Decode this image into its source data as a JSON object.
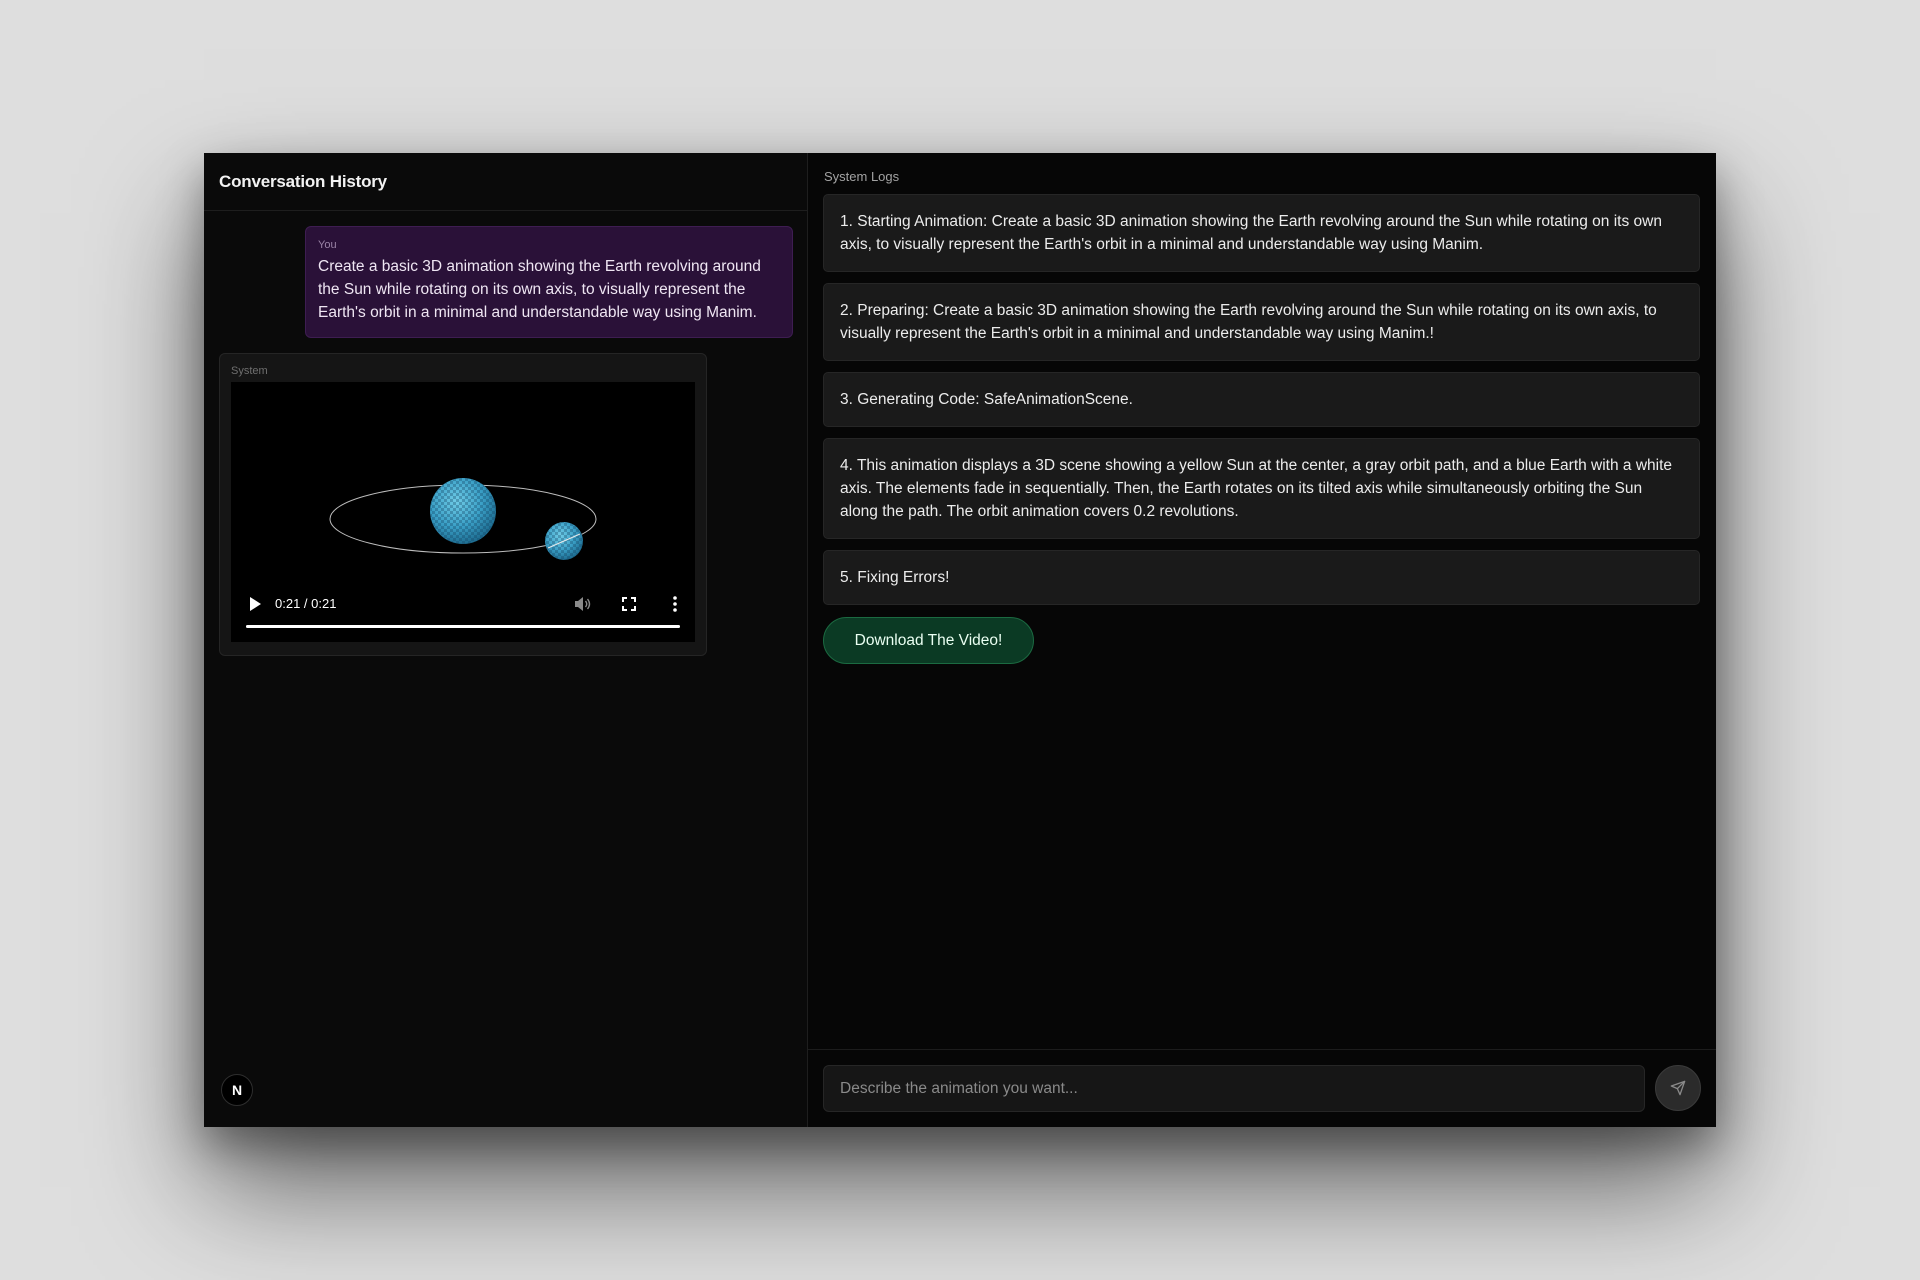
{
  "left_panel": {
    "title": "Conversation History",
    "user_message": {
      "label": "You",
      "text": "Create a basic 3D animation showing the Earth revolving around the Sun while rotating on its own axis, to visually represent the Earth's orbit in a minimal and understandable way using Manim."
    },
    "system_message": {
      "label": "System",
      "video": {
        "time": "0:21 / 0:21",
        "progress": 1.0,
        "icons": [
          "play-icon",
          "volume-icon",
          "fullscreen-icon",
          "more-options-icon"
        ]
      }
    },
    "logo": "N"
  },
  "right_panel": {
    "title": "System Logs",
    "logs": [
      "1. Starting Animation: Create a basic 3D animation showing the Earth revolving around the Sun while rotating on its own axis, to visually represent the Earth's orbit in a minimal and understandable way using Manim.",
      "2. Preparing: Create a basic 3D animation showing the Earth revolving around the Sun while rotating on its own axis, to visually represent the Earth's orbit in a minimal and understandable way using Manim.!",
      "3. Generating Code: SafeAnimationScene.",
      "4. This animation displays a 3D scene showing a yellow Sun at the center, a gray orbit path, and a blue Earth with a white axis. The elements fade in sequentially. Then, the Earth rotates on its tilted axis while simultaneously orbiting the Sun along the path. The orbit animation covers 0.2 revolutions.",
      "5. Fixing Errors!"
    ],
    "download_label": "Download The Video!",
    "input": {
      "placeholder": "Describe the animation you want...",
      "value": ""
    },
    "send_icon": "send-icon"
  },
  "colors": {
    "app_background": "#0a0a0a",
    "user_bubble": "#2a1138",
    "log_card": "#1a1a1a",
    "download_button": "#0b3a24",
    "planet": "#3aa0c8"
  }
}
